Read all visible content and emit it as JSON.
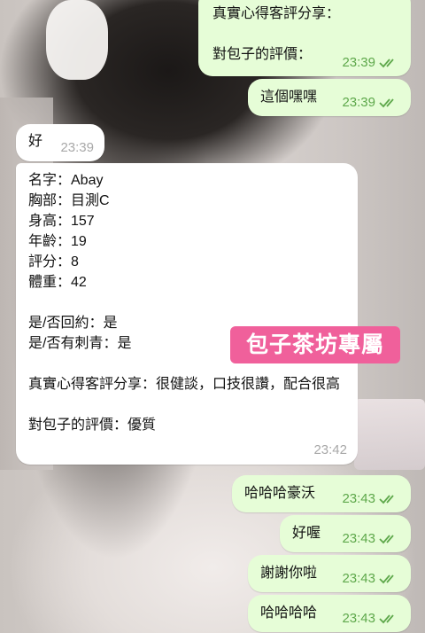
{
  "colors": {
    "outgoing_bubble": "#e6fdd7",
    "incoming_bubble": "#ffffff",
    "outgoing_time": "#5ea84b",
    "incoming_time": "#a8a8a8",
    "watermark_bg": "#f0609b"
  },
  "messages": [
    {
      "dir": "out",
      "text": "真實心得客評分享：\n\n對包子的評價：",
      "time": "23:39",
      "read": true
    },
    {
      "dir": "out",
      "text": "這個嘿嘿",
      "time": "23:39",
      "read": true
    },
    {
      "dir": "in",
      "text": "好",
      "time": "23:39"
    },
    {
      "dir": "in",
      "text": "名字：Abay\n胸部：目測C\n身高：157\n年齡：19\n評分：8\n體重：42\n\n是/否回約：是\n是/否有刺青：是\n\n真實心得客評分享：很健談，口技很讚，配合很高\n\n對包子的評價：優質",
      "time": "23:42"
    },
    {
      "dir": "out",
      "text": "哈哈哈豪沃",
      "time": "23:43",
      "read": true
    },
    {
      "dir": "out",
      "text": "好喔",
      "time": "23:43",
      "read": true
    },
    {
      "dir": "out",
      "text": "謝謝你啦",
      "time": "23:43",
      "read": true
    },
    {
      "dir": "out",
      "text": "哈哈哈哈",
      "time": "23:43",
      "read": true
    }
  ],
  "watermark": "包子茶坊專屬",
  "icons": {
    "read_receipt": "double-check-icon"
  }
}
